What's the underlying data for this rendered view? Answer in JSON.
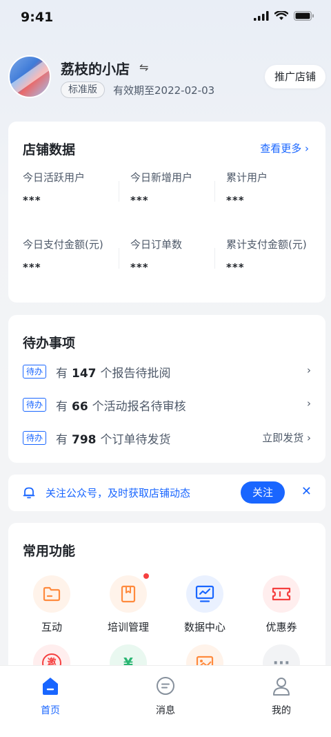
{
  "status": {
    "time": "9:41"
  },
  "header": {
    "shop_name": "荔枝的小店",
    "switch_icon": "swap-icon",
    "plan": "标准版",
    "expiry": "有效期至2022-02-03",
    "promote_label": "推广店铺"
  },
  "shop_data": {
    "title": "店铺数据",
    "more": "查看更多 ›",
    "stats": [
      {
        "label": "今日活跃用户",
        "value": "***"
      },
      {
        "label": "今日新增用户",
        "value": "***"
      },
      {
        "label": "累计用户",
        "value": "***"
      },
      {
        "label": "今日支付金额(元)",
        "value": "***"
      },
      {
        "label": "今日订单数",
        "value": "***"
      },
      {
        "label": "累计支付金额(元)",
        "value": "***"
      }
    ]
  },
  "todo": {
    "title": "待办事项",
    "items": [
      {
        "tag": "待办",
        "prefix": "有",
        "count": "147",
        "text": "个报告待批阅",
        "action": ""
      },
      {
        "tag": "待办",
        "prefix": "有",
        "count": "66",
        "text": "个活动报名待审核",
        "action": ""
      },
      {
        "tag": "待办",
        "prefix": "有",
        "count": "798",
        "text": "个订单待发货",
        "action": "立即发货"
      }
    ]
  },
  "notice": {
    "text": "关注公众号，及时获取店铺动态",
    "follow": "关注"
  },
  "functions": {
    "title": "常用功能",
    "items": [
      {
        "label": "互动",
        "icon": "folder-icon",
        "color": "#ff8a3d",
        "bg": "#fff3ea"
      },
      {
        "label": "培训管理",
        "icon": "book-icon",
        "color": "#ff8a3d",
        "bg": "#fff3ea"
      },
      {
        "label": "数据中心",
        "icon": "monitor-chart-icon",
        "color": "#1966ff",
        "bg": "#eaf1ff"
      },
      {
        "label": "优惠券",
        "icon": "coupon-icon",
        "color": "#f53f3f",
        "bg": "#ffeeee"
      }
    ],
    "row2_icons": [
      {
        "icon": "invite-icon",
        "color": "#f53f3f",
        "bg": "#ffeeee",
        "glyph": "邀"
      },
      {
        "icon": "money-bag-icon",
        "color": "#2bb673",
        "bg": "#e9f8f0",
        "glyph": "¥"
      },
      {
        "icon": "image-icon",
        "color": "#ff8a3d",
        "bg": "#fff3ea",
        "glyph": ""
      },
      {
        "icon": "more-icon",
        "color": "#86909c",
        "bg": "#f2f3f5",
        "glyph": "···"
      }
    ]
  },
  "tabbar": {
    "tabs": [
      {
        "label": "首页",
        "icon": "home-icon"
      },
      {
        "label": "消息",
        "icon": "message-icon"
      },
      {
        "label": "我的",
        "icon": "user-icon"
      }
    ]
  },
  "colors": {
    "accent": "#1966ff",
    "badge": "#f53f3f"
  }
}
